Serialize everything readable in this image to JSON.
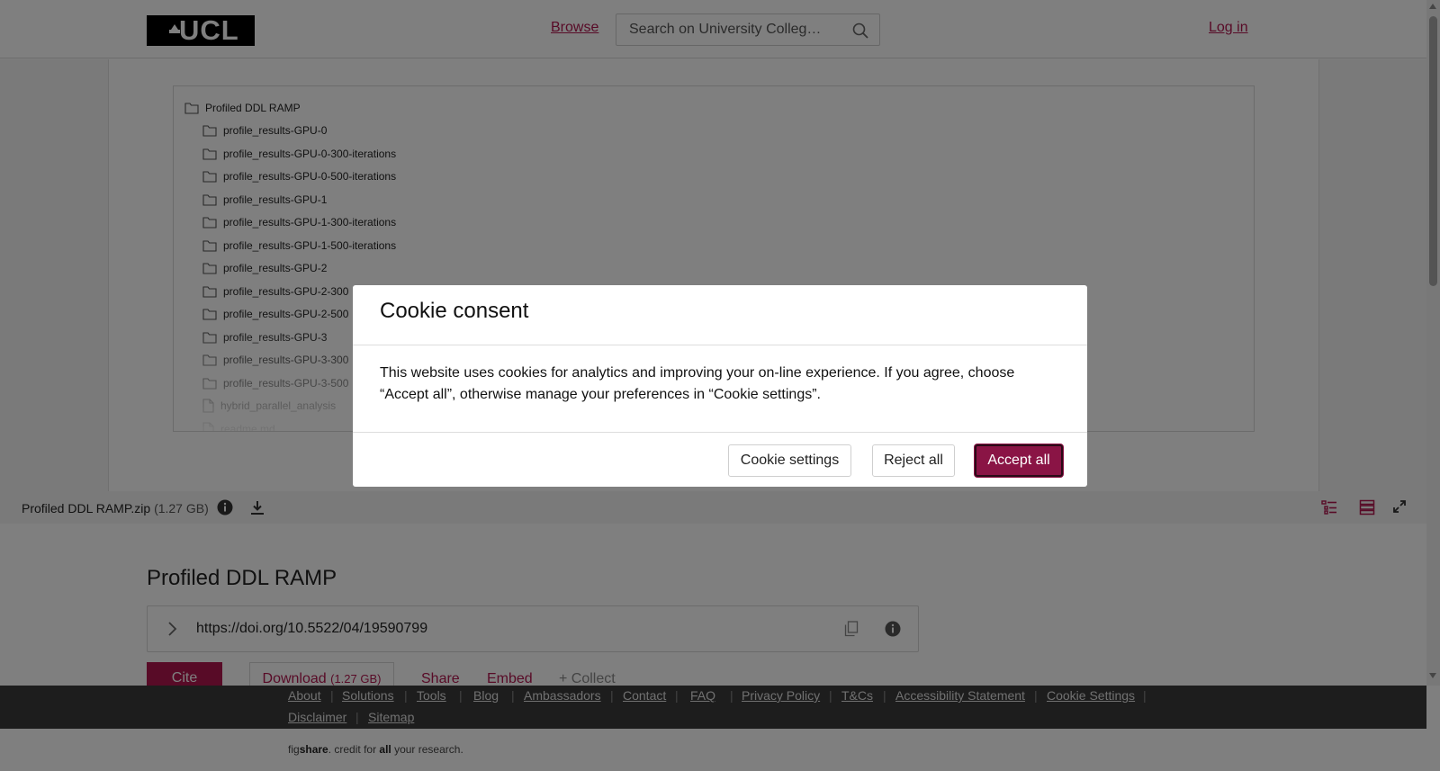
{
  "header": {
    "logo_text": "UCL",
    "browse_label": "Browse",
    "search_placeholder": "Search on University Colleg…",
    "login_label": "Log in"
  },
  "file_tree": {
    "root": "Profiled DDL RAMP",
    "items": [
      {
        "label": "profile_results-GPU-0",
        "type": "folder"
      },
      {
        "label": "profile_results-GPU-0-300-iterations",
        "type": "folder"
      },
      {
        "label": "profile_results-GPU-0-500-iterations",
        "type": "folder"
      },
      {
        "label": "profile_results-GPU-1",
        "type": "folder"
      },
      {
        "label": "profile_results-GPU-1-300-iterations",
        "type": "folder"
      },
      {
        "label": "profile_results-GPU-1-500-iterations",
        "type": "folder"
      },
      {
        "label": "profile_results-GPU-2",
        "type": "folder"
      },
      {
        "label": "profile_results-GPU-2-300",
        "type": "folder"
      },
      {
        "label": "profile_results-GPU-2-500",
        "type": "folder"
      },
      {
        "label": "profile_results-GPU-3",
        "type": "folder"
      },
      {
        "label": "profile_results-GPU-3-300",
        "type": "folder"
      },
      {
        "label": "profile_results-GPU-3-500",
        "type": "folder"
      },
      {
        "label": "hybrid_parallel_analysis",
        "type": "file"
      },
      {
        "label": "readme.md",
        "type": "file"
      }
    ]
  },
  "file_bar": {
    "filename": "Profiled DDL RAMP.zip",
    "size": "(1.27 GB)"
  },
  "item": {
    "title": "Profiled DDL RAMP",
    "doi": "https://doi.org/10.5522/04/19590799",
    "cite_label": "Cite",
    "download_label": "Download",
    "download_size": "(1.27 GB)",
    "share_label": "Share",
    "embed_label": "Embed",
    "collect_label": "+ Collect"
  },
  "footer": {
    "links": [
      "About",
      "Solutions",
      "Tools",
      "Blog",
      "Ambassadors",
      "Contact",
      "FAQ",
      "Privacy Policy",
      "T&Cs",
      "Accessibility Statement",
      "Cookie Settings",
      "Disclaimer",
      "Sitemap"
    ],
    "tagline_pre": "fig",
    "tagline_bold": "share",
    "tagline_mid": ". credit for ",
    "tagline_bold2": "all",
    "tagline_post": " your research."
  },
  "cookie_modal": {
    "title": "Cookie consent",
    "body": "This website uses cookies for analytics and improving your on-line experience. If you agree, choose “Accept all”, otherwise manage your preferences in “Cookie settings”.",
    "settings_label": "Cookie settings",
    "reject_label": "Reject all",
    "accept_label": "Accept all"
  },
  "colors": {
    "accent": "#b0164e",
    "accept_button": "#8a1445",
    "overlay": "rgba(0,0,0,0.5)"
  }
}
